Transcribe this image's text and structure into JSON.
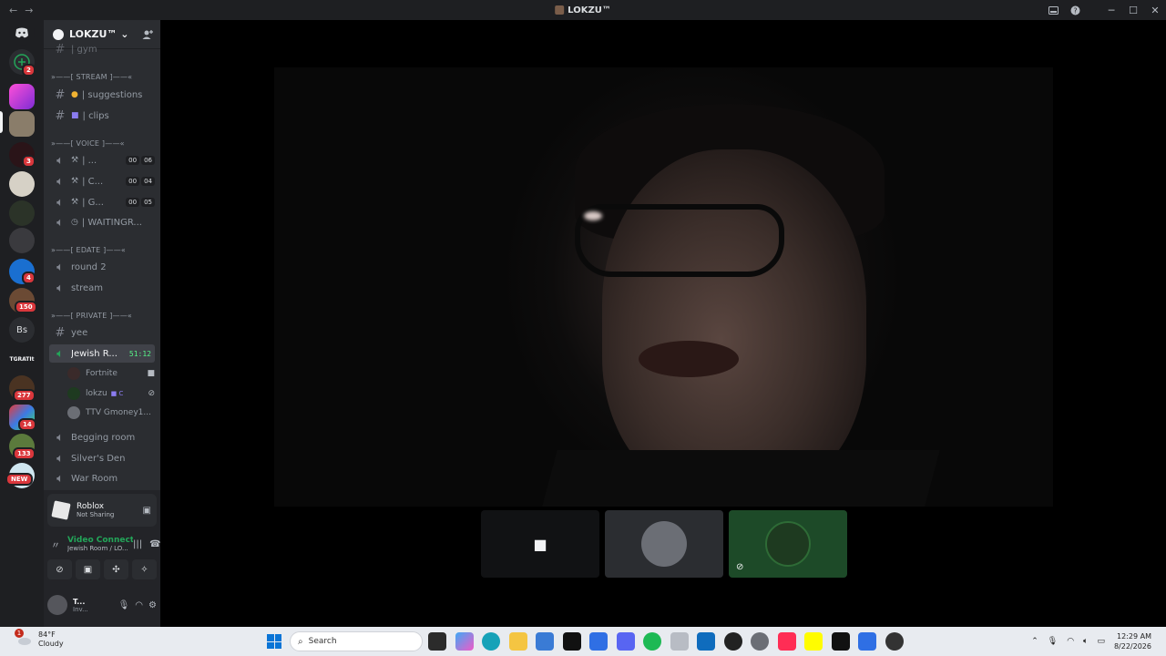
{
  "window": {
    "title": "LOKZU™",
    "back": "←",
    "forward": "→",
    "inbox_icon": "inbox-icon",
    "help_icon": "help-icon",
    "minimize": "─",
    "maximize": "☐",
    "close": "✕"
  },
  "guilds": {
    "items": [
      {
        "name": "direct-messages",
        "badge": ""
      },
      {
        "name": "add-server",
        "badge": "2"
      },
      {
        "name": "server-pink",
        "badge": ""
      },
      {
        "name": "server-lokzu",
        "badge": ""
      },
      {
        "name": "server-3",
        "badge": "3"
      },
      {
        "name": "server-4",
        "badge": ""
      },
      {
        "name": "server-5",
        "badge": ""
      },
      {
        "name": "server-6",
        "badge": ""
      },
      {
        "name": "server-7",
        "badge": "4"
      },
      {
        "name": "server-8",
        "badge": "150"
      },
      {
        "name": "server-bs",
        "badge": "",
        "label": "Bs"
      },
      {
        "name": "server-tgrat",
        "badge": "",
        "label": "TGRATIt"
      },
      {
        "name": "server-11",
        "badge": "277"
      },
      {
        "name": "server-12",
        "badge": "14"
      },
      {
        "name": "server-13",
        "badge": "133"
      },
      {
        "name": "server-14",
        "badge": "NEW"
      }
    ]
  },
  "sidebar": {
    "server_name": "LOKZU™",
    "server_chevron": "⌄",
    "invite_icon": "add-member-icon",
    "top_channel": "| gym",
    "categories": {
      "stream": "»——[ STREAM ]——«",
      "voice": "»——[ VOICE ]——«",
      "edate": "»——[ EDATE ]——«",
      "private": "»——[ PRIVATE ]——«"
    },
    "channels": {
      "suggestions": "| suggestions",
      "clips": "| clips",
      "voice1": "| ...",
      "voice2": "| C...",
      "voice3": "| G...",
      "waiting": "| WAITINGR...",
      "round2": "round 2",
      "stream": "stream",
      "yee": "yee",
      "jewish": "Jewish R...",
      "begging": "Begging room",
      "silvers": "Silver's Den",
      "war": "War Room"
    },
    "counters": {
      "voice1": [
        "00",
        "06"
      ],
      "voice2": [
        "00",
        "04"
      ],
      "voice3": [
        "00",
        "05"
      ]
    },
    "jewish_timer": "51:12",
    "members": [
      {
        "name": "Fortnite"
      },
      {
        "name": "lokzu"
      },
      {
        "name": "TTV Gmoney1..."
      }
    ]
  },
  "panel": {
    "activity_title": "Roblox",
    "activity_status": "Not Sharing",
    "vc_status": "Video Connected",
    "vc_location": "Jewish Room / LO...",
    "user_name": "T...",
    "user_status": "Inv..."
  },
  "taskbar": {
    "weather_temp": "84°F",
    "weather_desc": "Cloudy",
    "weather_badge": "1",
    "search_placeholder": "Search",
    "time": "12:29 AM",
    "date": "8/22/2026"
  },
  "colors": {
    "accent_green": "#23a559",
    "badge_red": "#da373c",
    "sidebar_bg": "#2b2d31",
    "guild_bg": "#1e1f22"
  }
}
